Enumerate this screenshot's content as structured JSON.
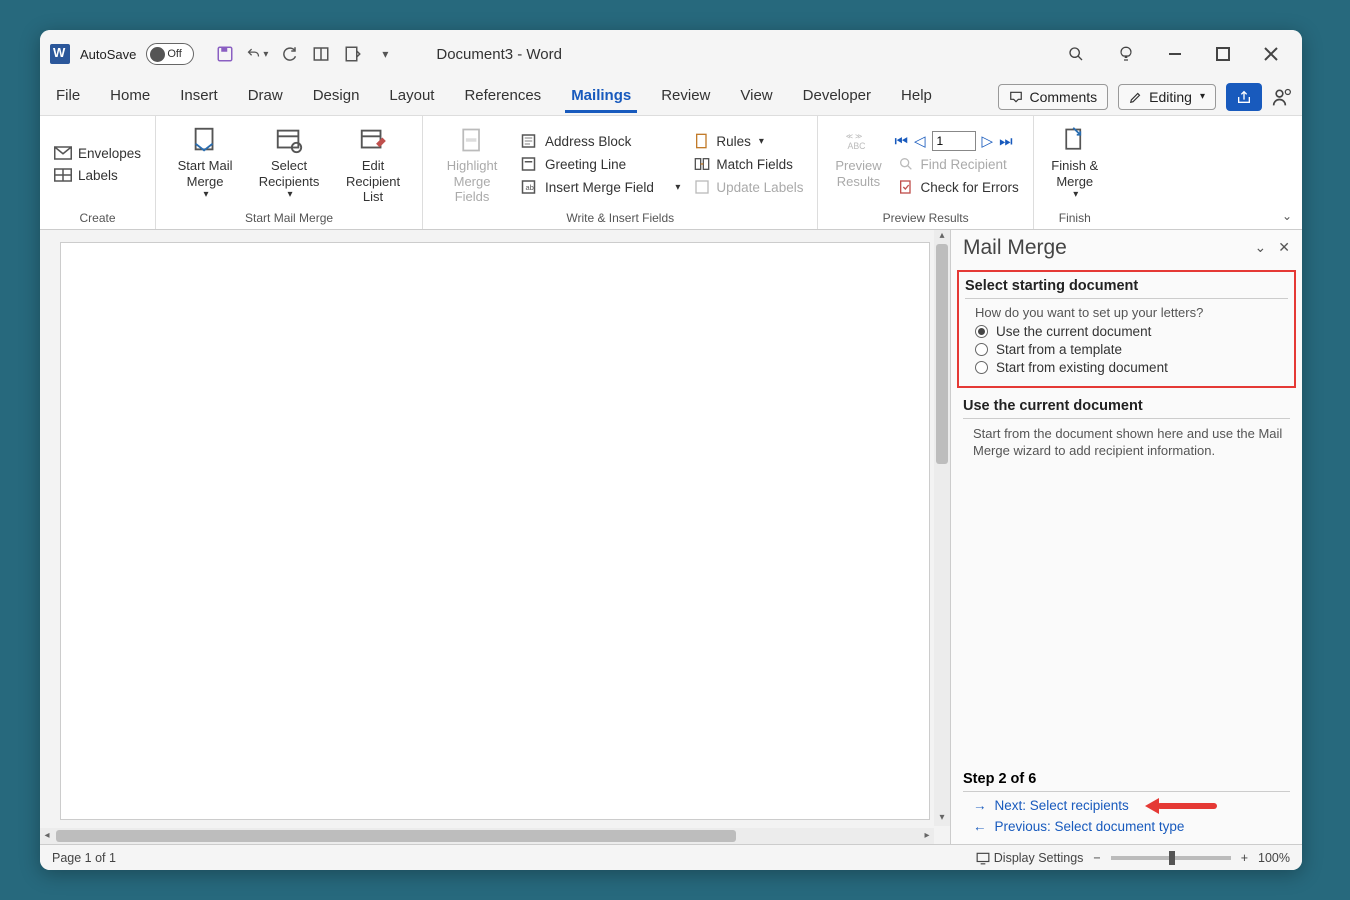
{
  "titlebar": {
    "autosave_label": "AutoSave",
    "autosave_state": "Off",
    "document_title": "Document3  -  Word"
  },
  "tabs": [
    "File",
    "Home",
    "Insert",
    "Draw",
    "Design",
    "Layout",
    "References",
    "Mailings",
    "Review",
    "View",
    "Developer",
    "Help"
  ],
  "active_tab": "Mailings",
  "tab_right": {
    "comments": "Comments",
    "editing": "Editing"
  },
  "ribbon": {
    "create": {
      "label": "Create",
      "envelopes": "Envelopes",
      "labels": "Labels"
    },
    "start": {
      "label": "Start Mail Merge",
      "start_mail_merge": "Start Mail Merge",
      "select_recipients": "Select Recipients",
      "edit_recipient_list": "Edit Recipient List"
    },
    "write": {
      "label": "Write & Insert Fields",
      "highlight": "Highlight Merge Fields",
      "address_block": "Address Block",
      "greeting_line": "Greeting Line",
      "insert_merge_field": "Insert Merge Field",
      "rules": "Rules",
      "match_fields": "Match Fields",
      "update_labels": "Update Labels"
    },
    "preview": {
      "label": "Preview Results",
      "preview_results": "Preview Results",
      "record": "1",
      "find_recipient": "Find Recipient",
      "check_errors": "Check for Errors"
    },
    "finish": {
      "label": "Finish",
      "finish_merge": "Finish & Merge"
    }
  },
  "pane": {
    "title": "Mail Merge",
    "section1_heading": "Select starting document",
    "question": "How do you want to set up your letters?",
    "opt1": "Use the current document",
    "opt2": "Start from a template",
    "opt3": "Start from existing document",
    "section2_heading": "Use the current document",
    "section2_desc": "Start from the document shown here and use the Mail Merge wizard to add recipient information.",
    "step_label": "Step 2 of 6",
    "next_label": "Next: Select recipients",
    "prev_label": "Previous: Select document type"
  },
  "statusbar": {
    "page": "Page 1 of 1",
    "display_settings": "Display Settings",
    "zoom": "100%"
  }
}
